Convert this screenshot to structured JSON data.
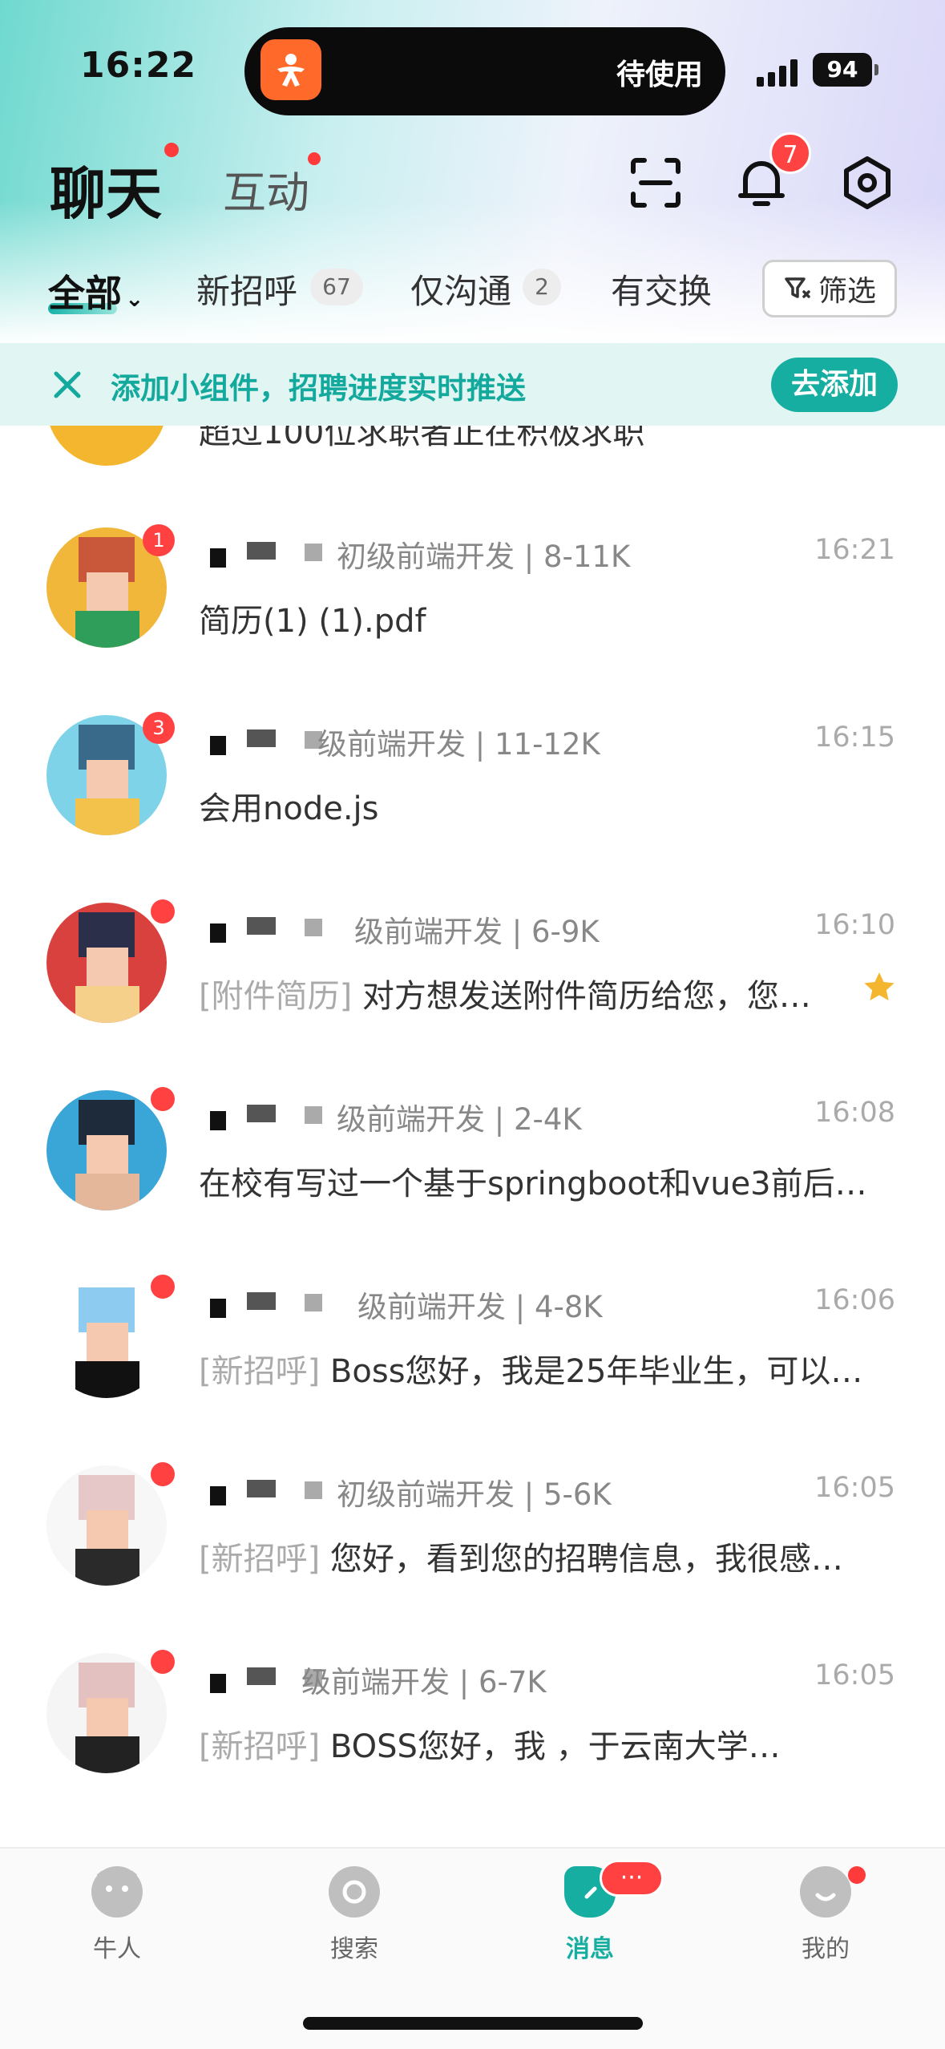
{
  "status": {
    "time": "16:22",
    "island_text": "待使用",
    "battery": "94"
  },
  "header": {
    "title": "聊天",
    "subtitle": "互动",
    "bell_count": "7"
  },
  "tabs": [
    {
      "label": "全部"
    },
    {
      "label": "新招呼",
      "count": "67"
    },
    {
      "label": "仅沟通",
      "count": "2"
    },
    {
      "label": "有交换"
    }
  ],
  "filter_label": "筛选",
  "banner": {
    "text": "添加小组件，招聘进度实时推送",
    "button": "去添加"
  },
  "partial_top": "超过100位求职者正在积极求职",
  "chats": [
    {
      "job": "初级前端开发 | 8-11K",
      "time": "16:21",
      "tag": "",
      "message": "简历(1) (1).pdf",
      "badge": "1",
      "colors": [
        "#f0b73a",
        "#c9583a",
        "#2e9e5a"
      ]
    },
    {
      "job": "级前端开发 | 11-12K",
      "time": "16:15",
      "tag": "",
      "message": "会用node.js",
      "badge": "3",
      "colors": [
        "#7fd3e8",
        "#3a6a8a",
        "#f3c24a"
      ]
    },
    {
      "job": "级前端开发 | 6-9K",
      "time": "16:10",
      "tag": "[附件简历]",
      "message": " 对方想发送附件简历给您，您…",
      "badge": "",
      "colors": [
        "#d9413f",
        "#2b2f4a",
        "#f4d08a"
      ]
    },
    {
      "job": "级前端开发 | 2-4K",
      "time": "16:08",
      "tag": "",
      "message": "在校有写过一个基于springboot和vue3前后…",
      "badge": "",
      "colors": [
        "#3aa6d8",
        "#1d2b3a",
        "#e4b79a"
      ]
    },
    {
      "job": "级前端开发 | 4-8K",
      "time": "16:06",
      "tag": "[新招呼]",
      "message": " Boss您好，我是25年毕业生，可以…",
      "badge": "",
      "colors": [
        "#ffffff",
        "#8ecbf0",
        "#111111"
      ]
    },
    {
      "job": "初级前端开发 | 5-6K",
      "time": "16:05",
      "tag": "[新招呼]",
      "message": " 您好，看到您的招聘信息，我很感…",
      "badge": "",
      "colors": [
        "#f7f7f7",
        "#e7c8c8",
        "#2a2a2a"
      ]
    },
    {
      "job": "级前端开发 | 6-7K",
      "time": "16:05",
      "tag": "[新招呼]",
      "message": " BOSS您好，我 ，于云南大学…",
      "badge": "",
      "colors": [
        "#f5f5f5",
        "#e3c1c1",
        "#222222"
      ]
    }
  ],
  "nav": [
    {
      "label": "牛人"
    },
    {
      "label": "搜索"
    },
    {
      "label": "消息",
      "badge": "···"
    },
    {
      "label": "我的"
    }
  ],
  "colors": {
    "accent": "#17aea2",
    "badge": "#ff4141"
  }
}
